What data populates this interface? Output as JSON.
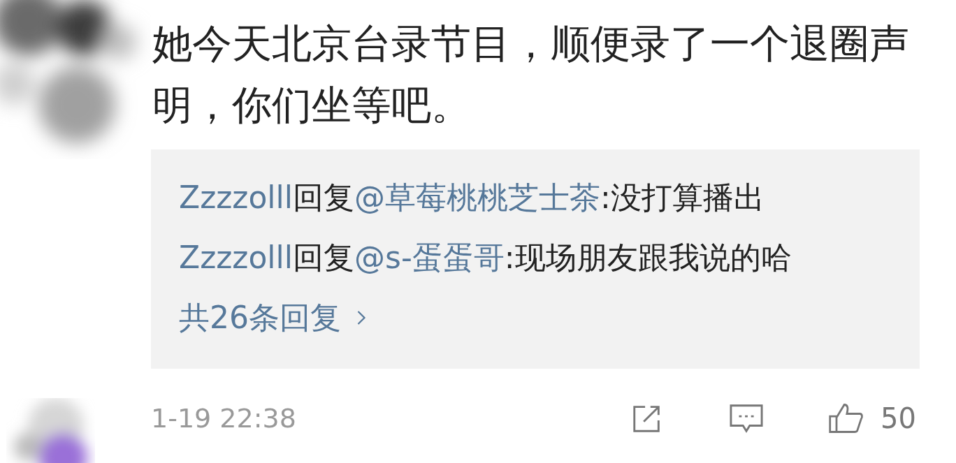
{
  "comment": {
    "text": "她今天北京台录节目，顺便录了一个退圈声明，你们坐等吧。",
    "replies": [
      {
        "user": "Zzzzolll",
        "action": "回复",
        "target": "@草莓桃桃芝士茶",
        "text": ":没打算播出"
      },
      {
        "user": "Zzzzolll",
        "action": "回复",
        "target": "@s-蛋蛋哥",
        "text": ":现场朋友跟我说的哈"
      }
    ],
    "more": "共26条回复",
    "time": "1-19 22:38",
    "likes": "50"
  }
}
